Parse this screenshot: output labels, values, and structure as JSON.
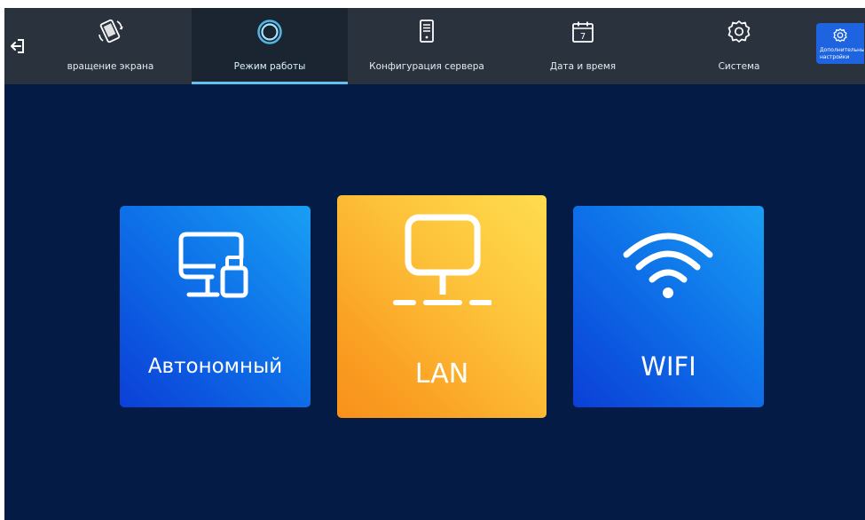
{
  "topbar": {
    "exit_icon": "exit-icon",
    "tabs": [
      {
        "label": "вращение экрана",
        "icon": "screen-rotation-icon",
        "active": false
      },
      {
        "label": "Режим работы",
        "icon": "work-mode-ring-icon",
        "active": true
      },
      {
        "label": "Конфигурация сервера",
        "icon": "server-icon",
        "active": false
      },
      {
        "label": "Дата и время",
        "icon": "calendar-icon",
        "active": false
      },
      {
        "label": "Система",
        "icon": "gear-icon",
        "active": false
      }
    ],
    "calendar_day": "7",
    "extra_settings": {
      "label": "Дополнительные настройки",
      "icon": "gear-icon"
    }
  },
  "modes": [
    {
      "label": "Автономный",
      "icon": "monitor-usb-icon",
      "selected": false
    },
    {
      "label": "LAN",
      "icon": "lan-monitor-icon",
      "selected": true
    },
    {
      "label": "WIFI",
      "icon": "wifi-icon",
      "selected": false
    }
  ],
  "colors": {
    "background": "#041c45",
    "topbar": "#2a323e",
    "active_tab_underline": "#61c2ee",
    "card_blue": "#0e73e9",
    "card_selected": "#fdc23a",
    "extra_button": "#1e64e1"
  }
}
